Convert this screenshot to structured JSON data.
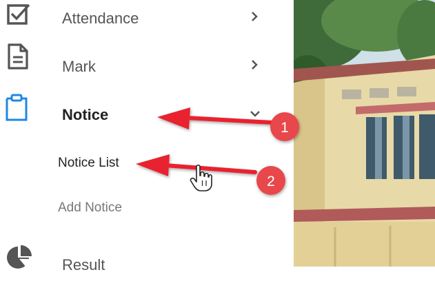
{
  "sidebar": {
    "items": [
      {
        "label": "Attendance",
        "icon": "checkbox-icon"
      },
      {
        "label": "Mark",
        "icon": "document-icon"
      },
      {
        "label": "Notice",
        "icon": "clipboard-icon",
        "active": true
      },
      {
        "label": "Result",
        "icon": "pie-chart-icon"
      }
    ],
    "notice_submenu": [
      {
        "label": "Notice List",
        "hovered": true
      },
      {
        "label": "Add Notice"
      }
    ]
  },
  "annotations": [
    {
      "label": "1"
    },
    {
      "label": "2"
    }
  ],
  "colors": {
    "accent_blue": "#1e88e5",
    "arrow_red": "#e8222d",
    "badge_red": "#e8474c",
    "icon_gray": "#555555"
  }
}
